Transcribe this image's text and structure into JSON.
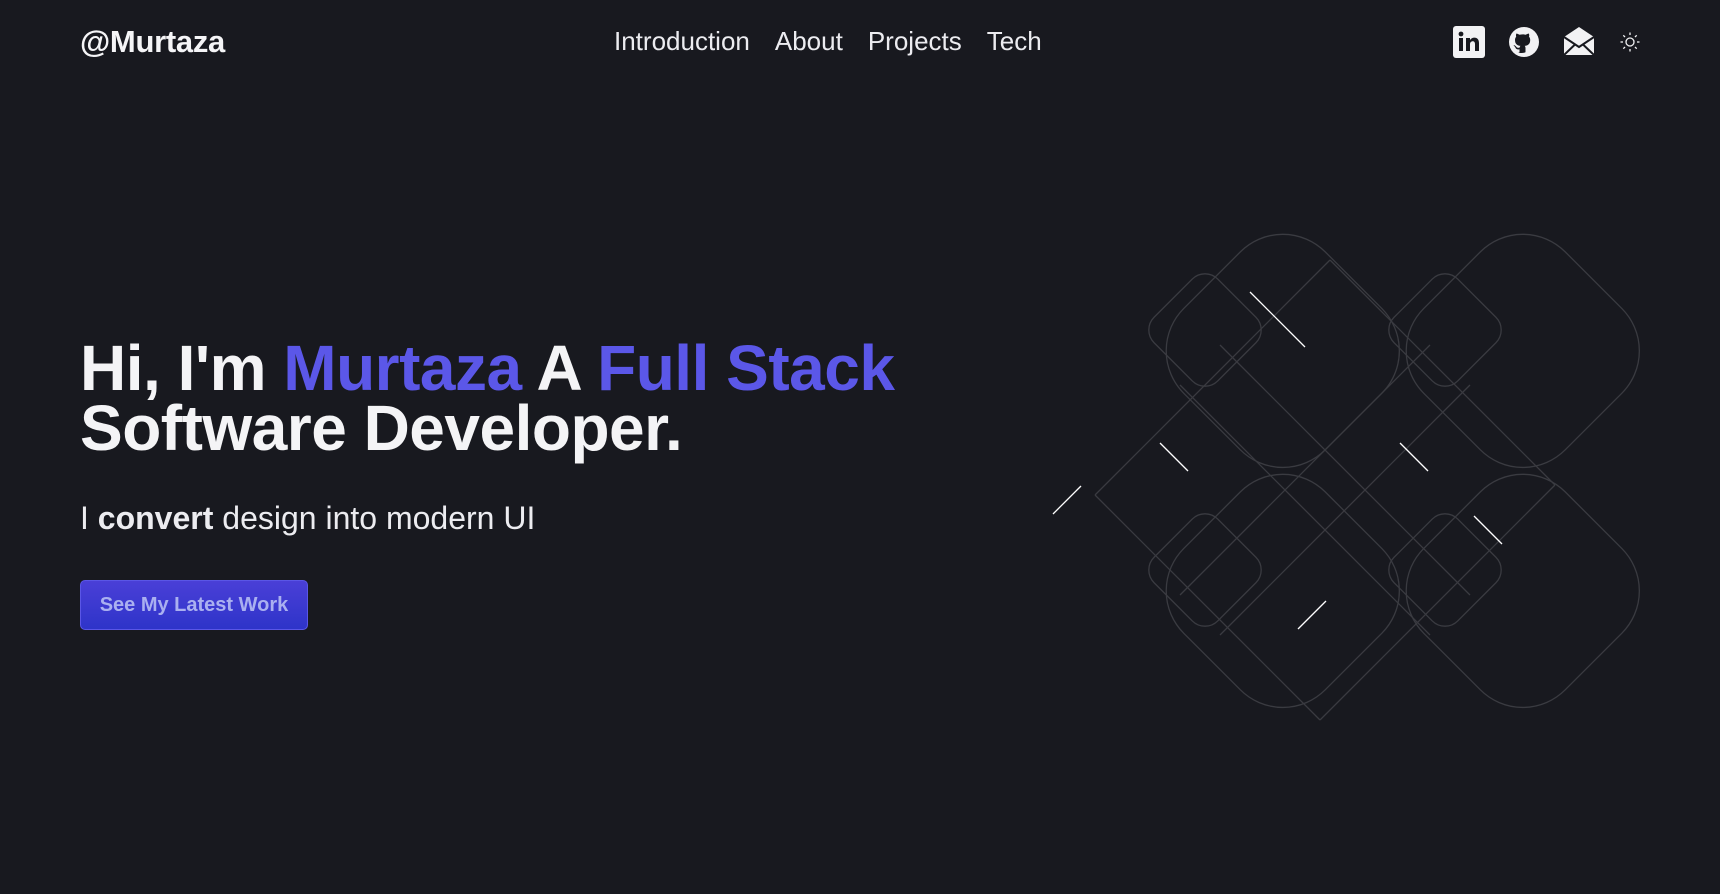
{
  "header": {
    "logo": "@Murtaza",
    "nav": [
      "Introduction",
      "About",
      "Projects",
      "Tech"
    ],
    "socials": {
      "linkedin": "linkedin-icon",
      "github": "github-icon",
      "email": "email-icon",
      "theme": "sun-icon"
    }
  },
  "hero": {
    "greeting": "Hi, I'm ",
    "name": "Murtaza",
    "connector": " A ",
    "role_accent": "Full Stack",
    "role_rest": "Software Developer.",
    "sub_prefix": "I ",
    "sub_bold": "convert",
    "sub_rest": " design into modern UI",
    "cta_label": "See My Latest Work"
  },
  "colors": {
    "background": "#18191f",
    "accent": "#5b57e8",
    "button": "#3a39d3"
  }
}
